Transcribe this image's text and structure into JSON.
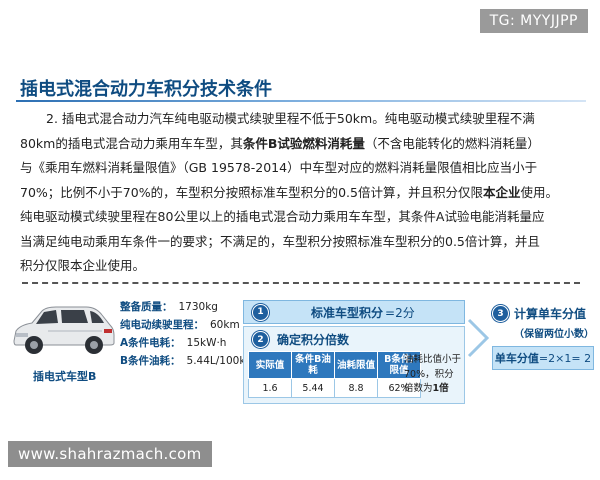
{
  "watermark_top": "TG: MYYJJPP",
  "watermark_bottom": "www.shahrazmach.com",
  "title": "插电式混合动力车积分技术条件",
  "paragraph": {
    "line1": "2. 插电式混合动力汽车纯电驱动模式续驶里程不低于50km。纯电驱动模式续驶里程不满",
    "line2a": "80km的插电式混合动力乘用车车型，其",
    "line2b": "条件B试验燃料消耗量",
    "line2c": "（不含电能转化的燃料消耗量）",
    "line3": "与《乘用车燃料消耗量限值》（GB 19578-2014）中车型对应的燃料消耗量限值相比应当小于",
    "line4a": "70%；比例不小于70%的，车型积分按照标准车型积分的0.5倍计算，并且积分仅限",
    "line4b": "本企业",
    "line4c": "使用。",
    "line5": "纯电驱动模式续驶里程在80公里以上的插电式混合动力乘用车车型，其条件A试验电能消耗量应",
    "line6": "当满足纯电动乘用车条件一的要求；不满足的，车型积分按照标准车型积分的0.5倍计算，并且",
    "line7": "积分仅限本企业使用。"
  },
  "car": {
    "label": "插电式车型B",
    "specs": [
      {
        "key": "整备质量：",
        "value": "1730kg"
      },
      {
        "key": "纯电动续驶里程：",
        "value": "60km"
      },
      {
        "key": "A条件电耗：",
        "value": "15kW·h"
      },
      {
        "key": "B条件油耗：",
        "value": "5.44L/100km"
      }
    ]
  },
  "step1": {
    "num": "1",
    "label": "标准车型积分",
    "value": "=2分"
  },
  "step2": {
    "num": "2",
    "label": "确定积分倍数",
    "table": {
      "headers": [
        "实际值",
        "条件B油耗",
        "油耗限值",
        "B条件/限值"
      ],
      "row": [
        "1.6",
        "5.44",
        "8.8",
        "62%"
      ]
    },
    "note_a": "油耗比值小于70%，积分倍数为",
    "note_b": "1倍"
  },
  "step3": {
    "num": "3",
    "label": "计算单车分值",
    "sub": "（保留两位小数）",
    "result_label": "单车分值",
    "result_value": "=2×1= 2"
  },
  "colors": {
    "accent": "#0f4c81",
    "header_fill": "#2e78bd",
    "panel_fill": "#c5e3f7"
  }
}
